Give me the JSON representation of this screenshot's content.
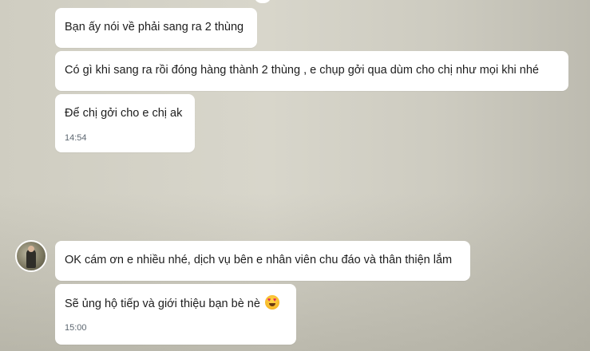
{
  "messages": [
    {
      "text": "Bạn ấy nói về phải sang ra 2 thùng"
    },
    {
      "text": "Có gì khi sang ra rồi đóng hàng thành 2 thùng , e chụp gởi qua dùm cho chị như mọi khi nhé"
    },
    {
      "text": "Để chị gởi cho e chị ak",
      "time": "14:54"
    },
    {
      "text": "OK cám ơn e nhiều nhé, dịch vụ bên e nhân viên chu đáo và thân thiện lắm"
    },
    {
      "text": "Sẽ ủng hộ tiếp và giới thiệu bạn bè nè",
      "emoji": "heart-eyes-emoji",
      "time": "15:00"
    }
  ],
  "colors": {
    "bubble": "#ffffff",
    "text": "#1d1d1d",
    "time": "#5c6670"
  }
}
